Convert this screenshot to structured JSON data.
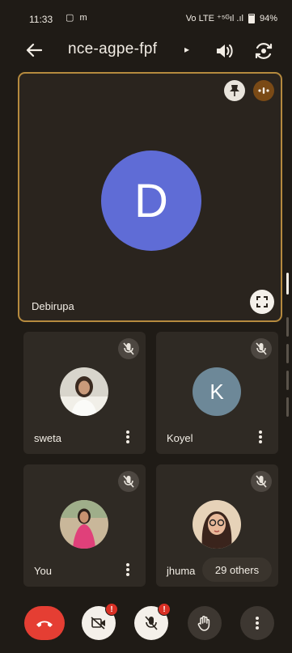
{
  "status_bar": {
    "time": "11:33",
    "left_icons": "▢ m",
    "right_icons": "Vo LTE ⁺⁵ᴳıl .ıl",
    "battery": "94%"
  },
  "header": {
    "title": "nce-agpe-fpf",
    "chevron": "▸"
  },
  "main_tile": {
    "initial": "D",
    "name": "Debirupa",
    "avatar_color": "#5f6cd6"
  },
  "tiles": [
    {
      "name": "sweta",
      "avatar": "photo"
    },
    {
      "name": "Koyel",
      "initial": "K",
      "avatar_color": "#6d8898"
    },
    {
      "name": "You",
      "avatar": "photo"
    },
    {
      "name": "jhuma",
      "avatar": "photo"
    }
  ],
  "others_chip": "29 others",
  "controls": {
    "cam_badge": "!",
    "mic_badge": "!"
  },
  "colors": {
    "background": "#1f1b16",
    "active_border": "#b58a3e",
    "end_call": "#e53e33"
  }
}
